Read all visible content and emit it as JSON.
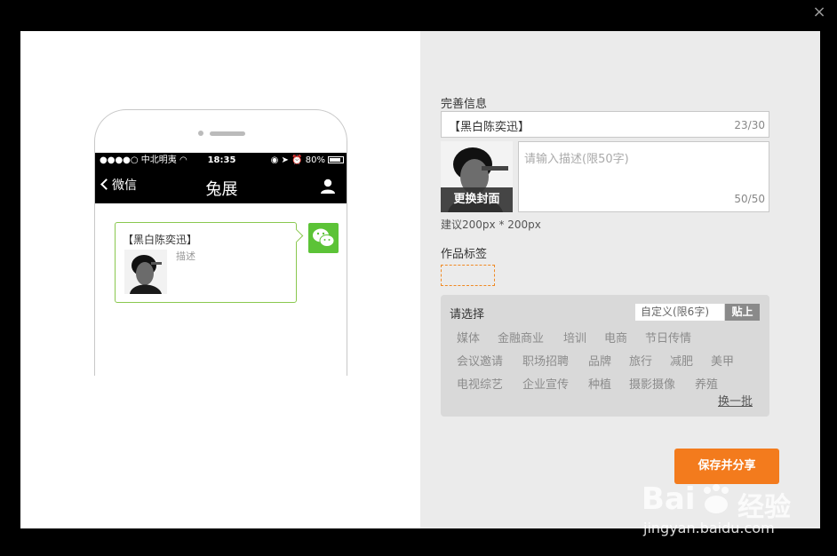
{
  "close_label": "×",
  "phone": {
    "status": {
      "carrier": "●●●●○ 中北明夷 ",
      "time": "18:35",
      "battery": "80%"
    },
    "nav": {
      "back_label": "微信",
      "title": "兔展"
    },
    "message": {
      "title": "【黑白陈奕迅】",
      "desc": "描述"
    }
  },
  "form": {
    "section_info": "完善信息",
    "title_value": "【黑白陈奕迅】",
    "title_counter": "23/30",
    "change_cover": "更换封面",
    "desc_placeholder": "请输入描述(限50字)",
    "desc_counter": "50/50",
    "cover_hint": "建议200px * 200px",
    "section_tags": "作品标签"
  },
  "tags": {
    "choose_label": "请选择",
    "custom_placeholder": "自定义(限6字)",
    "paste_label": "贴上",
    "rows": [
      [
        "媒体",
        "金融商业",
        "培训",
        "电商",
        "节日传情"
      ],
      [
        "会议邀请",
        "职场招聘",
        "品牌",
        "旅行",
        "减肥",
        "美甲"
      ],
      [
        "电视综艺",
        "企业宣传",
        "种植",
        "摄影摄像",
        "养殖"
      ]
    ],
    "refresh_label": "换一批"
  },
  "save_label": "保存并分享",
  "watermark": {
    "brand_a": "Bai",
    "brand_b": "经验",
    "url": "jingyan.baidu.com"
  },
  "colors": {
    "accent": "#f37b1d",
    "wechat_green": "#5cc337",
    "bubble_border": "#8ac84f"
  }
}
